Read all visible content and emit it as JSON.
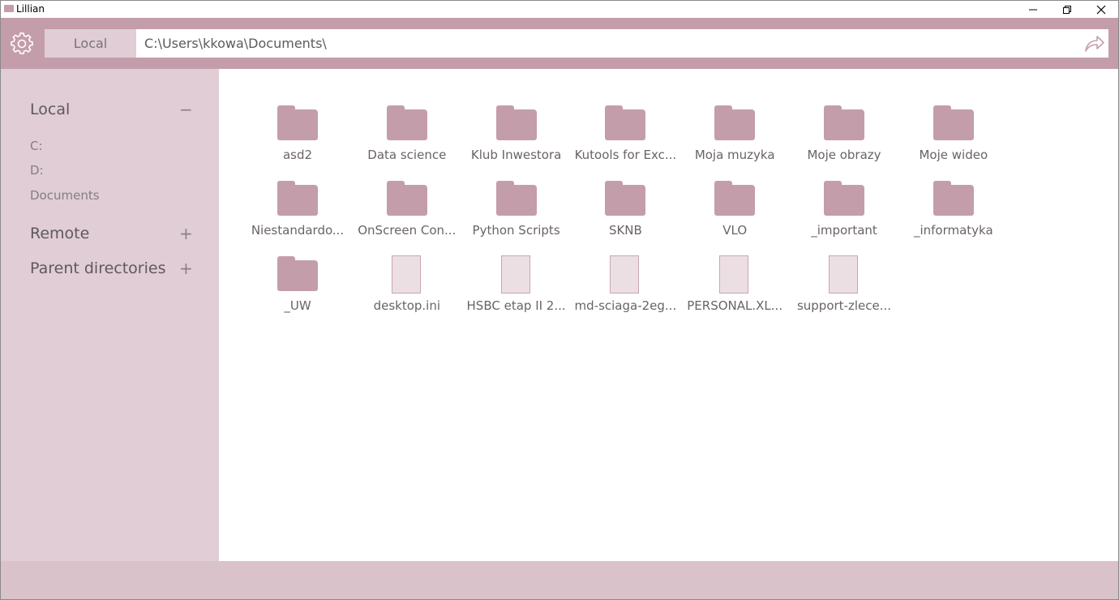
{
  "window": {
    "title": "Lillian",
    "controls": [
      "minimize",
      "restore",
      "close"
    ]
  },
  "toolbar": {
    "settings_icon": "gear-icon",
    "location_tab": "Local",
    "path": "C:\\Users\\kkowa\\Documents\\",
    "go_icon": "share-arrow-icon"
  },
  "sidebar": {
    "sections": [
      {
        "title": "Local",
        "toggle": "−",
        "expanded": true,
        "items": [
          "C:",
          "D:",
          "Documents"
        ]
      },
      {
        "title": "Remote",
        "toggle": "+",
        "expanded": false
      },
      {
        "title": "Parent directories",
        "toggle": "+",
        "expanded": false
      }
    ]
  },
  "files": [
    {
      "name": "asd2",
      "type": "folder"
    },
    {
      "name": "Data science",
      "type": "folder"
    },
    {
      "name": "Klub Inwestora",
      "type": "folder"
    },
    {
      "name": "Kutools for Exc...",
      "type": "folder"
    },
    {
      "name": "Moja muzyka",
      "type": "folder"
    },
    {
      "name": "Moje obrazy",
      "type": "folder"
    },
    {
      "name": "Moje wideo",
      "type": "folder"
    },
    {
      "name": "Niestandardo...",
      "type": "folder"
    },
    {
      "name": "OnScreen Con...",
      "type": "folder"
    },
    {
      "name": "Python Scripts",
      "type": "folder"
    },
    {
      "name": "SKNB",
      "type": "folder"
    },
    {
      "name": "VLO",
      "type": "folder"
    },
    {
      "name": "_important",
      "type": "folder"
    },
    {
      "name": "_informatyka",
      "type": "folder"
    },
    {
      "name": "_UW",
      "type": "folder"
    },
    {
      "name": "desktop.ini",
      "type": "file"
    },
    {
      "name": "HSBC etap II 2...",
      "type": "file"
    },
    {
      "name": "md-sciaga-2eg...",
      "type": "file"
    },
    {
      "name": "PERSONAL.XL...",
      "type": "file"
    },
    {
      "name": "support-zlece...",
      "type": "file"
    }
  ],
  "colors": {
    "accent": "#c49dab",
    "sidebar_bg": "#e0cdd5",
    "statusbar_bg": "#dac2cb",
    "file_fill": "#ecdfe4"
  }
}
